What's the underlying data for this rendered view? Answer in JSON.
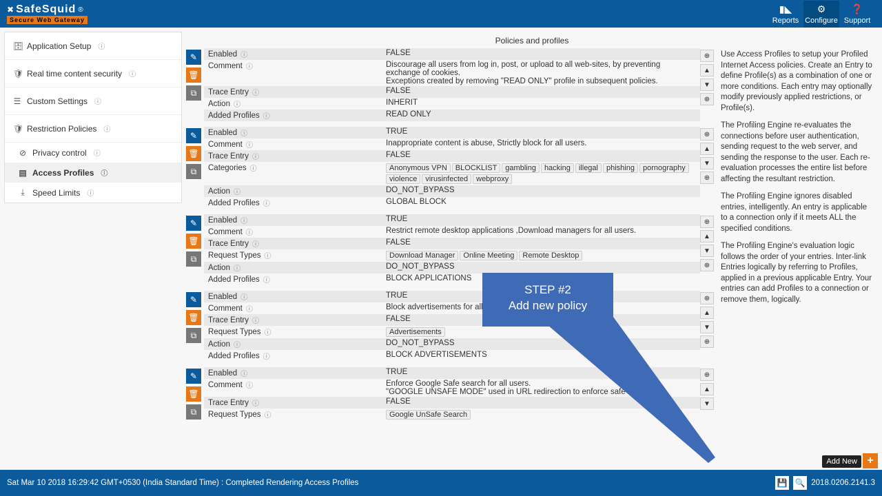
{
  "brand": {
    "name": "SafeSquid",
    "reg": "®",
    "tagline": "Secure Web Gateway"
  },
  "topnav": {
    "reports": "Reports",
    "configure": "Configure",
    "support": "Support"
  },
  "sidebar": {
    "app_setup": "Application Setup",
    "realtime": "Real time content security",
    "custom": "Custom Settings",
    "restrict": "Restriction Policies",
    "privacy": "Privacy control",
    "access": "Access Profiles",
    "speed": "Speed Limits"
  },
  "page_title": "Policies and profiles",
  "labels": {
    "enabled": "Enabled",
    "comment": "Comment",
    "trace": "Trace Entry",
    "action": "Action",
    "added": "Added Profiles",
    "categories": "Categories",
    "reqtypes": "Request Types"
  },
  "policies": [
    {
      "enabled": "FALSE",
      "comment": "Discourage all users from log in, post, or upload to all web-sites, by preventing exchange of cookies.\nExceptions created by removing \"READ ONLY\" profile in subsequent policies.",
      "trace": "FALSE",
      "action": "INHERIT",
      "added": "READ ONLY"
    },
    {
      "enabled": "TRUE",
      "comment": "Inappropriate content is abuse, Strictly block for all users.",
      "trace": "FALSE",
      "categories": [
        "Anonymous VPN",
        "BLOCKLIST",
        "gambling",
        "hacking",
        "illegal",
        "phishing",
        "pornography",
        "violence",
        "virusinfected",
        "webproxy"
      ],
      "action": "DO_NOT_BYPASS",
      "added": "GLOBAL BLOCK"
    },
    {
      "enabled": "TRUE",
      "comment": "Restrict remote desktop applications ,Download managers for all users.",
      "trace": "FALSE",
      "reqtypes": [
        "Download Manager",
        "Online Meeting",
        "Remote Desktop"
      ],
      "action": "DO_NOT_BYPASS",
      "added": "BLOCK APPLICATIONS"
    },
    {
      "enabled": "TRUE",
      "comment": "Block advertisements for all users.",
      "trace": "FALSE",
      "reqtypes": [
        "Advertisements"
      ],
      "action": "DO_NOT_BYPASS",
      "added": "BLOCK ADVERTISEMENTS"
    },
    {
      "enabled": "TRUE",
      "comment": "Enforce Google Safe search for all users.\n\"GOOGLE UNSAFE MODE\" used in URL redirection to enforce safe search.",
      "trace": "FALSE",
      "reqtypes": [
        "Google UnSafe Search"
      ]
    }
  ],
  "help": {
    "p1": "Use Access Profiles to setup your Profiled Internet Access policies. Create an Entry to define Profile(s) as a combination of one or more conditions. Each entry may optionally modify previously applied restrictions, or Profile(s).",
    "p2": "The Profiling Engine re-evaluates the connections before user authentication, sending request to the web server, and sending the response to the user. Each re-evaluation processes the entire list before affecting the resultant restriction.",
    "p3": "The Profiling Engine ignores disabled entries, intelligently. An entry is applicable to a connection only if it meets ALL the specified conditions.",
    "p4": "The Profiling Engine's evaluation logic follows the order of your entries. Inter-link Entries logically by referring to Profiles, applied in a previous applicable Entry. Your entries can add Profiles to a connection or remove them, logically."
  },
  "callout": {
    "line1": "STEP #2",
    "line2": "Add new policy"
  },
  "add_new": "Add New",
  "footer": {
    "status": "Sat Mar 10 2018 16:29:42 GMT+0530 (India Standard Time) : Completed Rendering Access Profiles",
    "version": "2018.0206.2141.3"
  }
}
